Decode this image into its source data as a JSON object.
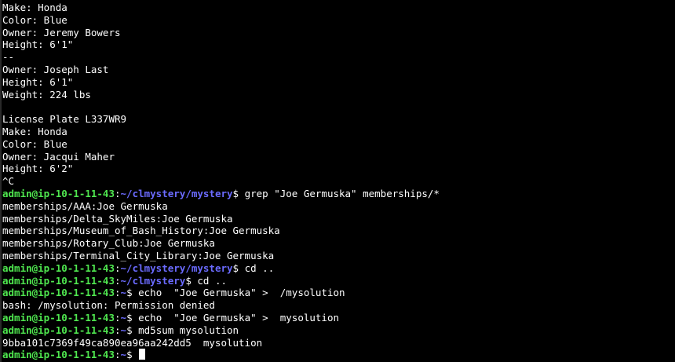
{
  "terminal": {
    "output_lines": [
      "Make: Honda",
      "Color: Blue",
      "Owner: Jeremy Bowers",
      "Height: 6'1\"",
      "--",
      "Owner: Joseph Last",
      "Height: 6'1\"",
      "Weight: 224 lbs",
      "",
      "License Plate L337WR9",
      "Make: Honda",
      "Color: Blue",
      "Owner: Jacqui Maher",
      "Height: 6'2\"",
      "^C"
    ],
    "prompt1": {
      "user": "admin@ip-10-1-11-43",
      "sep": ":",
      "path": "~/clmystery/mystery",
      "suffix": "$ ",
      "command": "grep \"Joe Germuska\" memberships/*"
    },
    "grep_results": [
      "memberships/AAA:Joe Germuska",
      "memberships/Delta_SkyMiles:Joe Germuska",
      "memberships/Museum_of_Bash_History:Joe Germuska",
      "memberships/Rotary_Club:Joe Germuska",
      "memberships/Terminal_City_Library:Joe Germuska"
    ],
    "prompt2": {
      "user": "admin@ip-10-1-11-43",
      "sep": ":",
      "path": "~/clmystery/mystery",
      "suffix": "$ ",
      "command": "cd .."
    },
    "prompt3": {
      "user": "admin@ip-10-1-11-43",
      "sep": ":",
      "path": "~/clmystery",
      "suffix": "$ ",
      "command": "cd .."
    },
    "prompt4": {
      "user": "admin@ip-10-1-11-43",
      "sep": ":",
      "path": "~",
      "suffix": "$ ",
      "command": "echo  \"Joe Germuska\" >  /mysolution"
    },
    "error_line": "bash: /mysolution: Permission denied",
    "prompt5": {
      "user": "admin@ip-10-1-11-43",
      "sep": ":",
      "path": "~",
      "suffix": "$ ",
      "command": "echo  \"Joe Germuska\" >  mysolution"
    },
    "prompt6": {
      "user": "admin@ip-10-1-11-43",
      "sep": ":",
      "path": "~",
      "suffix": "$ ",
      "command": "md5sum mysolution"
    },
    "md5_output": "9bba101c7369f49ca890ea96aa242dd5  mysolution",
    "prompt7": {
      "user": "admin@ip-10-1-11-43",
      "sep": ":",
      "path": "~",
      "suffix": "$ ",
      "command": ""
    }
  },
  "colors": {
    "background": "#000000",
    "text": "#ffffff",
    "prompt_user": "#4fe64f",
    "prompt_path": "#6b6bff"
  }
}
